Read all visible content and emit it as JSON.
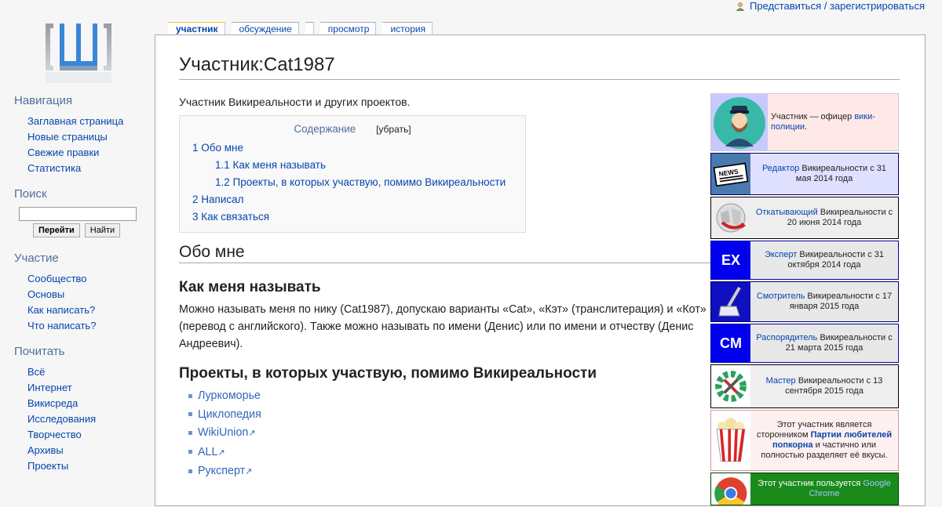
{
  "personal": {
    "login": "Представиться / зарегистрироваться"
  },
  "tabs": [
    "участник",
    "обсуждение",
    "",
    "просмотр",
    "история"
  ],
  "sidebar": {
    "navigation": {
      "title": "Навигация",
      "items": [
        "Заглавная страница",
        "Новые страницы",
        "Свежие правки",
        "Статистика"
      ]
    },
    "search": {
      "title": "Поиск",
      "value": "",
      "go": "Перейти",
      "find": "Найти"
    },
    "participation": {
      "title": "Участие",
      "items": [
        "Сообщество",
        "Основы",
        "Как написать?",
        "Что написать?"
      ]
    },
    "read": {
      "title": "Почитать",
      "items": [
        "Всё",
        "Интернет",
        "Викисреда",
        "Исследования",
        "Творчество",
        "Архивы",
        "Проекты"
      ]
    }
  },
  "page": {
    "title": "Участник:Cat1987",
    "intro": "Участник Викиреальности и других проектов.",
    "toc": {
      "title": "Содержание",
      "hide": "[убрать]",
      "items": [
        {
          "text": "1 Обо мне",
          "level": 1
        },
        {
          "text": "1.1 Как меня называть",
          "level": 2
        },
        {
          "text": "1.2 Проекты, в которых участвую, помимо Викиреальности",
          "level": 2
        },
        {
          "text": "2 Написал",
          "level": 1
        },
        {
          "text": "3 Как связаться",
          "level": 1
        }
      ]
    },
    "about_heading": "Обо мне",
    "name_heading": "Как меня называть",
    "name_text": "Можно называть меня по нику (Cat1987), допускаю варианты «Cat», «Кэт» (транслитерация) и «Кот» (перевод с английского). Также можно называть по имени (Денис) или по имени и отчеству (Денис Андреевич).",
    "projects_heading": "Проекты, в которых участвую, помимо Викиреальности",
    "projects": [
      {
        "name": "Луркоморье",
        "external": false
      },
      {
        "name": "Циклопедия",
        "external": false
      },
      {
        "name": "WikiUnion",
        "external": true
      },
      {
        "name": "ALL",
        "external": true
      },
      {
        "name": "Рукспeрт",
        "external": true
      }
    ]
  },
  "userboxes": [
    {
      "icon": "police-officer-icon",
      "bg": "#ffe8e8",
      "imgbg": "#c8c8ff",
      "border": "#cccccc",
      "pre": "Участник — офицер ",
      "link": "вики-полиции",
      "post": ".",
      "align": "left"
    },
    {
      "icon": "newspaper-icon",
      "bg": "#e0e0ff",
      "imgbg": "#4a7ab0",
      "border": "#000066",
      "link": "Редактор",
      "post": " Викиреальности с 31 мая 2014 года"
    },
    {
      "icon": "wiki-globe-icon",
      "bg": "#eeeeee",
      "imgbg": "#eeeeee",
      "border": "#000000",
      "link": "Откатывающий",
      "post": " Викиреальности с 20 июня 2014 года"
    },
    {
      "icon": "ex-badge-icon",
      "label": "EX",
      "bg": "#e8e8e8",
      "imgbg": "#0000ee",
      "border": "#0000aa",
      "link": "Эксперт",
      "post": " Викиреальности с 31 октября 2014 года"
    },
    {
      "icon": "mop-icon",
      "bg": "#e8e8e8",
      "imgbg": "#1010c0",
      "border": "#000066",
      "link": "Смотритель",
      "post": " Викиреальности с 17 января 2015 года"
    },
    {
      "icon": "cm-badge-icon",
      "label": "CM",
      "bg": "#e8e8e8",
      "imgbg": "#0000ee",
      "border": "#0000aa",
      "link": "Распорядитель",
      "post": " Викиреальности с 21 марта 2015 года"
    },
    {
      "icon": "gear-tools-icon",
      "bg": "#eeeeee",
      "imgbg": "#ffffff",
      "border": "#000000",
      "link": "Мастер",
      "post": " Викиреальности с 13 сентября 2015 года"
    },
    {
      "icon": "popcorn-icon",
      "bg": "#fff0f0",
      "imgbg": "#ffffff",
      "border": "#cc9999",
      "pre": "Этот участник является сторонником ",
      "boldlink": "Партии любителей попкорна",
      "post": " и частично или полностью разделяет её вкусы."
    },
    {
      "icon": "chrome-icon",
      "bg": "#1a8a1a",
      "imgbg": "#ffffff",
      "border": "#004400",
      "pre": "Этот участник пользуется ",
      "link": "Google Chrome",
      "post": "",
      "dark": true
    }
  ]
}
